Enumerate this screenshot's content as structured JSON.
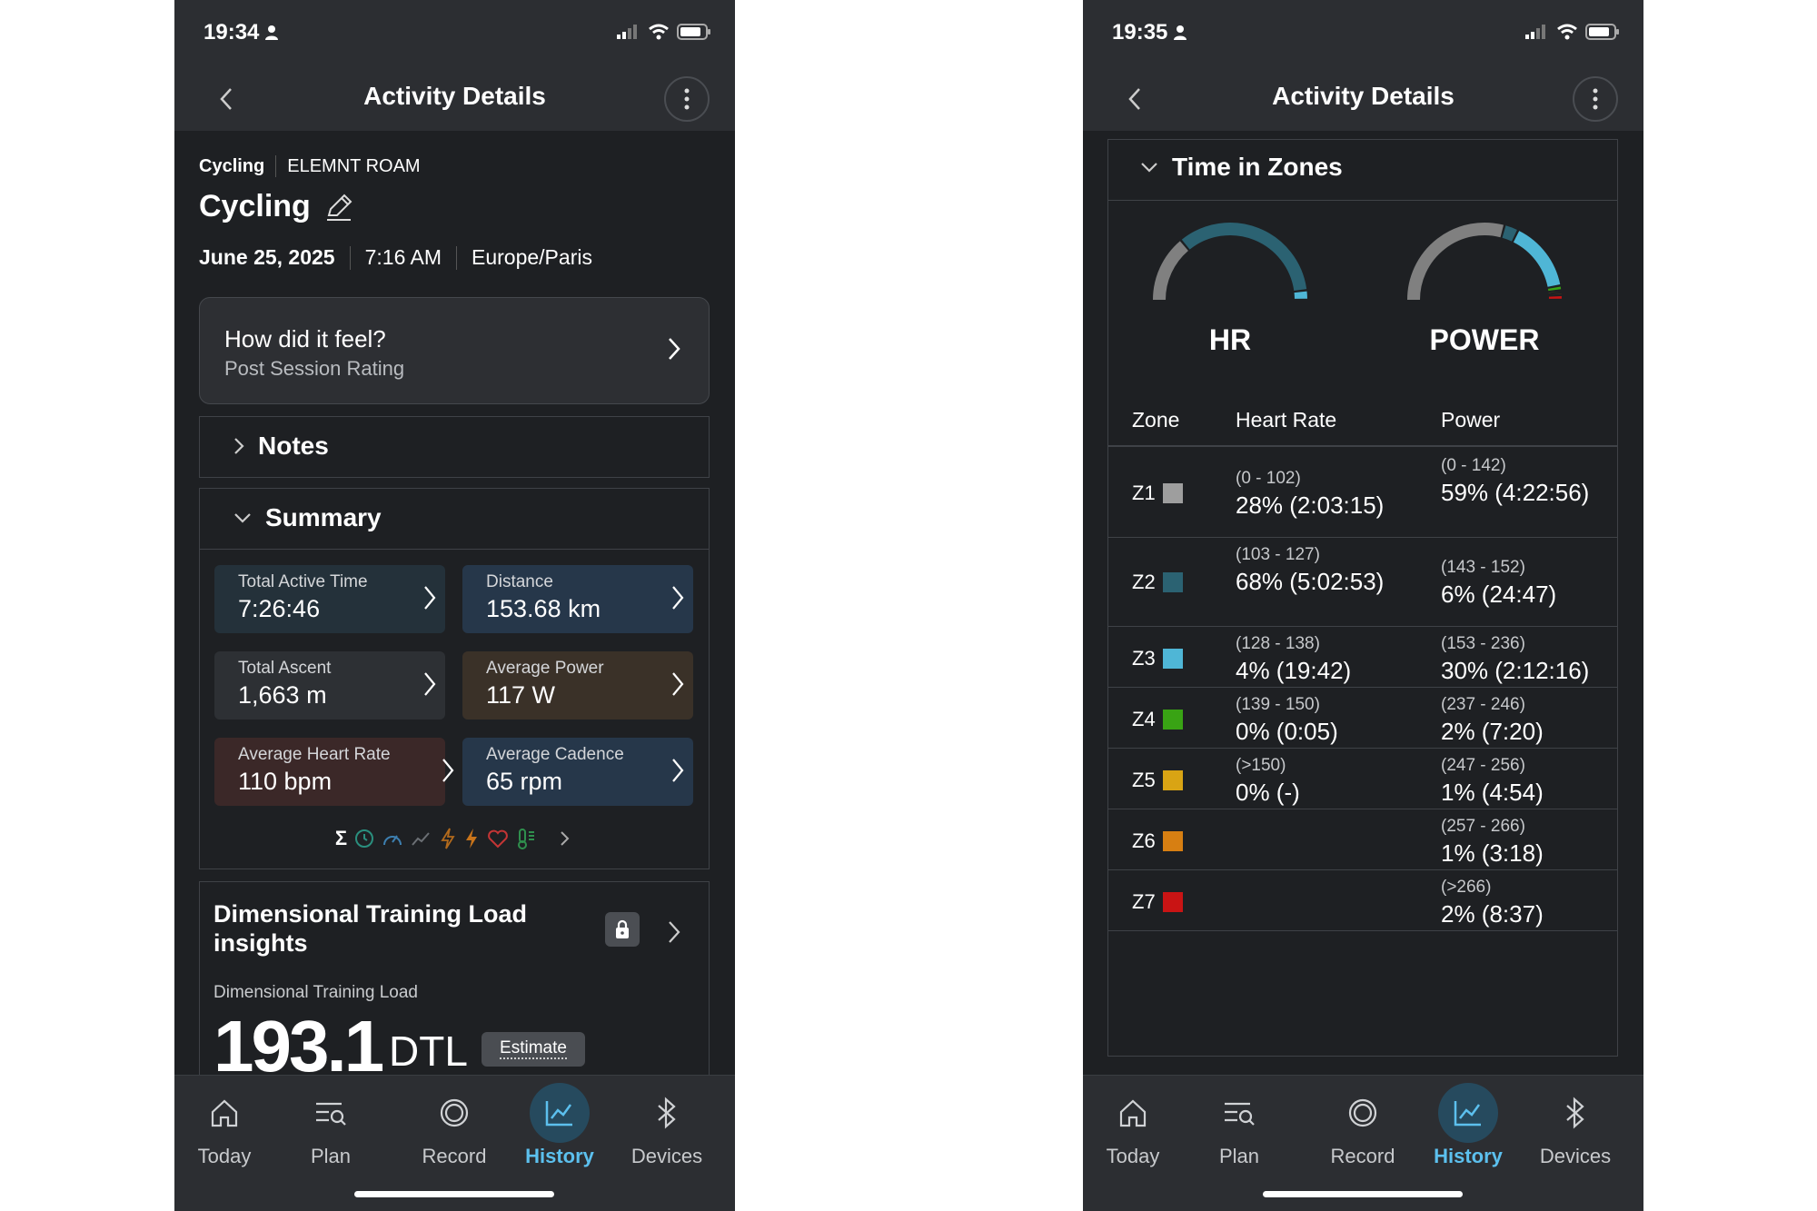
{
  "left": {
    "status": {
      "time": "19:34"
    },
    "header": {
      "title": "Activity Details"
    },
    "meta": {
      "sport": "Cycling",
      "device": "ELEMNT ROAM"
    },
    "activity": {
      "title": "Cycling",
      "date": "June 25, 2025",
      "time": "7:16 AM",
      "timezone": "Europe/Paris"
    },
    "feel_card": {
      "title": "How did it feel?",
      "subtitle": "Post Session Rating"
    },
    "notes": {
      "title": "Notes"
    },
    "summary": {
      "title": "Summary",
      "tiles": [
        {
          "label": "Total Active Time",
          "value": "7:26:46",
          "color": "#24313a"
        },
        {
          "label": "Distance",
          "value": "153.68 km",
          "color": "#26374a"
        },
        {
          "label": "Total Ascent",
          "value": "1,663 m",
          "color": "#2d3034"
        },
        {
          "label": "Average Power",
          "value": "117 W",
          "color": "#3a3128"
        },
        {
          "label": "Average Heart Rate",
          "value": "110 bpm",
          "color": "#3b2828"
        },
        {
          "label": "Average Cadence",
          "value": "65 rpm",
          "color": "#26374a"
        }
      ],
      "metric_icons": [
        "sigma-icon",
        "clock-icon",
        "speedometer-icon",
        "elevation-icon",
        "power-outline-icon",
        "power-filled-icon",
        "heart-icon",
        "thermometer-icon",
        "chevron-right-icon"
      ]
    },
    "dtl": {
      "title": "Dimensional Training Load insights",
      "subtitle": "Dimensional Training Load",
      "value": "193.1",
      "unit": "DTL",
      "badge": "Estimate"
    }
  },
  "right": {
    "status": {
      "time": "19:35"
    },
    "header": {
      "title": "Activity Details"
    },
    "zones": {
      "title": "Time in Zones",
      "gauges": [
        {
          "label": "HR",
          "shares": [
            0.28,
            0.68,
            0.04,
            0.0,
            0.0
          ]
        },
        {
          "label": "POWER",
          "shares": [
            0.59,
            0.06,
            0.3,
            0.02,
            0.01,
            0.01,
            0.02
          ]
        }
      ],
      "columns": [
        "Zone",
        "Heart Rate",
        "Power"
      ],
      "rows": [
        {
          "zone": "Z1",
          "color": "#9e9e9e",
          "hr_range": "(0 - 102)",
          "hr_value": "28% (2:03:15)",
          "pw_range": "(0 - 142)",
          "pw_value": "59% (4:22:56)"
        },
        {
          "zone": "Z2",
          "color": "#2b6272",
          "hr_range": "(103 - 127)",
          "hr_value": "68% (5:02:53)",
          "pw_range": "(143 - 152)",
          "pw_value": "6% (24:47)"
        },
        {
          "zone": "Z3",
          "color": "#4fb6d6",
          "hr_range": "(128 - 138)",
          "hr_value": "4% (19:42)",
          "pw_range": "(153 - 236)",
          "pw_value": "30% (2:12:16)"
        },
        {
          "zone": "Z4",
          "color": "#39a314",
          "hr_range": "(139 - 150)",
          "hr_value": "0% (0:05)",
          "pw_range": "(237 - 246)",
          "pw_value": "2% (7:20)"
        },
        {
          "zone": "Z5",
          "color": "#d9a414",
          "hr_range": "(>150)",
          "hr_value": "0% (-)",
          "pw_range": "(247 - 256)",
          "pw_value": "1% (4:54)"
        },
        {
          "zone": "Z6",
          "color": "#d77f12",
          "hr_range": "",
          "hr_value": "",
          "pw_range": "(257 - 266)",
          "pw_value": "1% (3:18)"
        },
        {
          "zone": "Z7",
          "color": "#c91414",
          "hr_range": "",
          "hr_value": "",
          "pw_range": "(>266)",
          "pw_value": "2% (8:37)"
        }
      ]
    }
  },
  "nav": {
    "items": [
      {
        "label": "Today",
        "icon": "home-icon"
      },
      {
        "label": "Plan",
        "icon": "plan-icon"
      },
      {
        "label": "Record",
        "icon": "record-icon"
      },
      {
        "label": "History",
        "icon": "history-chart-icon",
        "active": true
      },
      {
        "label": "Devices",
        "icon": "bluetooth-icon"
      }
    ],
    "accent": "#5cc0ee"
  }
}
